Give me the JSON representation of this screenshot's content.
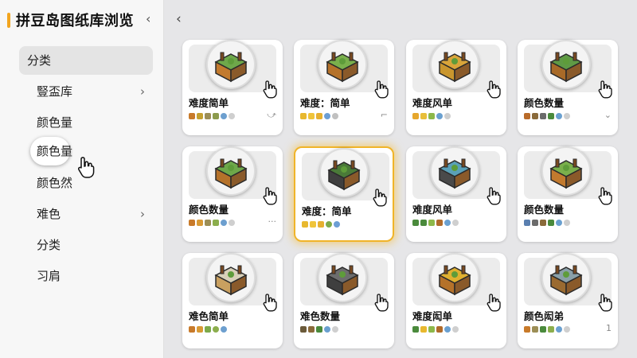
{
  "app": {
    "title": "拼豆岛图纸库浏览",
    "collapse_icon": "‹",
    "back_icon": "‹",
    "accent": "#f2a51f",
    "selected_glow": "#f0b429"
  },
  "sidebar": {
    "items": [
      {
        "label": "分类",
        "active": true
      },
      {
        "label": "豎盃库",
        "chevron": "›"
      },
      {
        "label": "颜色量"
      },
      {
        "label": "颜色量",
        "hovered": true
      },
      {
        "label": "颜色然"
      },
      {
        "label": "难色",
        "chevron": "›"
      },
      {
        "label": "分类"
      },
      {
        "label": "习肩"
      }
    ]
  },
  "cards": [
    {
      "title": "难度简单",
      "meta": "⤻",
      "swatches": [
        "#c87a2a",
        "#c4a030",
        "#9c8e56",
        "#8c9b4d",
        "#6d9fcf",
        "#cfcfcf"
      ]
    },
    {
      "title": "难度：简单",
      "meta": "⌐",
      "swatches": [
        "#e8b82e",
        "#f0c43a",
        "#e6b030",
        "#6c9ed4",
        "#c0c0c0"
      ]
    },
    {
      "title": "难度风单",
      "meta": "",
      "swatches": [
        "#e6a72d",
        "#e8be3a",
        "#8db84a",
        "#6aa0d0",
        "#cfcfcf"
      ]
    },
    {
      "title": "颜色数量",
      "meta": "⌄",
      "swatches": [
        "#b96b2a",
        "#8a6a3a",
        "#6b6b6b",
        "#4a8a3c",
        "#6aa0d0",
        "#cfcfcf"
      ]
    },
    {
      "title": "颜色数量",
      "meta": "···",
      "swatches": [
        "#c87a2a",
        "#d89a35",
        "#9c8e56",
        "#8cae4d",
        "#6d9fcf",
        "#cfcfcf"
      ]
    },
    {
      "title": "难度：简单",
      "meta": "",
      "swatches": [
        "#e8b82e",
        "#f0c43a",
        "#e6b030",
        "#7daa4a",
        "#6c9ed4"
      ],
      "selected": true
    },
    {
      "title": "难度风单",
      "meta": "",
      "swatches": [
        "#4a8a3c",
        "#4a8a3c",
        "#8db84a",
        "#b06a2a",
        "#6aa0d0",
        "#cfcfcf"
      ]
    },
    {
      "title": "颜色数量",
      "meta": "",
      "swatches": [
        "#5a7fb0",
        "#6b6b6b",
        "#8a6a3a",
        "#4a8a3c",
        "#6aa0d0",
        "#cfcfcf"
      ]
    },
    {
      "title": "难色简单",
      "meta": "",
      "swatches": [
        "#c87a2a",
        "#d89a35",
        "#7daa4a",
        "#8cae4d",
        "#6d9fcf"
      ]
    },
    {
      "title": "难色数量",
      "meta": "",
      "swatches": [
        "#6b5a3a",
        "#8a6a3a",
        "#4a8a3c",
        "#6aa0d0",
        "#cfcfcf"
      ]
    },
    {
      "title": "难度闳单",
      "meta": "",
      "swatches": [
        "#4a8a3c",
        "#e8b82e",
        "#8db84a",
        "#b06a2a",
        "#6aa0d0",
        "#cfcfcf"
      ]
    },
    {
      "title": "颜色闳弟",
      "meta": "1",
      "swatches": [
        "#c87a2a",
        "#9c8e56",
        "#4a8a3c",
        "#8cae4d",
        "#6aa0d0",
        "#cfcfcf"
      ]
    }
  ]
}
